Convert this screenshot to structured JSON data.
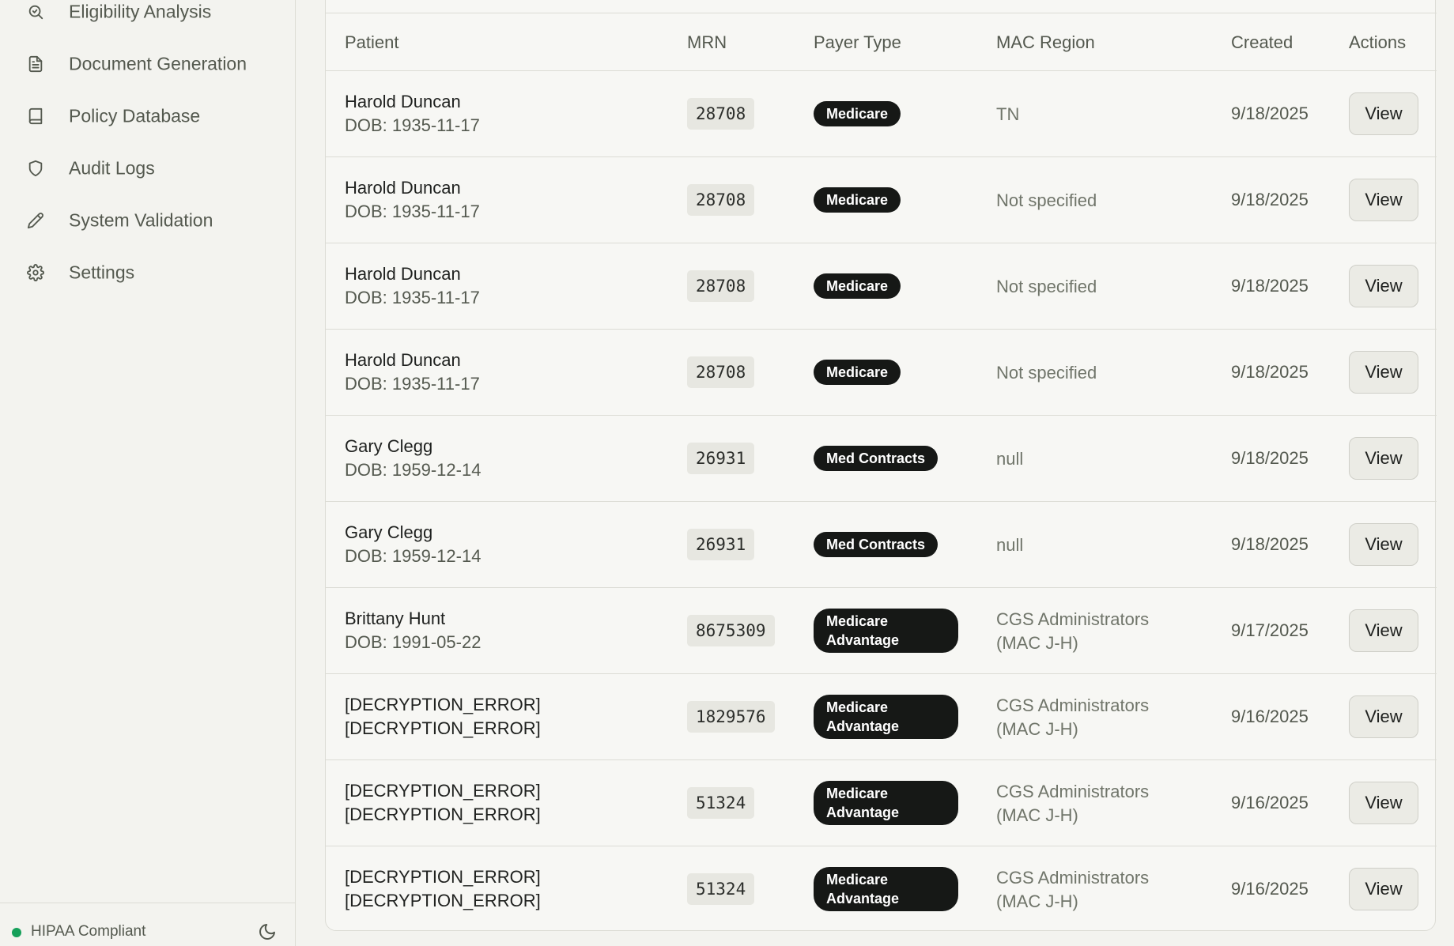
{
  "sidebar": {
    "items": [
      {
        "label": "Eligibility Analysis",
        "icon": "search-check-icon"
      },
      {
        "label": "Document Generation",
        "icon": "document-icon"
      },
      {
        "label": "Policy Database",
        "icon": "book-icon"
      },
      {
        "label": "Audit Logs",
        "icon": "shield-icon"
      },
      {
        "label": "System Validation",
        "icon": "pencil-icon"
      },
      {
        "label": "Settings",
        "icon": "gear-icon"
      }
    ],
    "footer": {
      "status": "HIPAA Compliant",
      "status_color": "#16a05a",
      "toggle_icon": "moon-icon"
    }
  },
  "table": {
    "headers": {
      "patient": "Patient",
      "mrn": "MRN",
      "payer": "Payer Type",
      "mac": "MAC Region",
      "created": "Created",
      "actions": "Actions"
    },
    "rows": [
      {
        "name": "Harold Duncan",
        "sub": "DOB: 1935-11-17",
        "mrn": "28708",
        "payer": "Medicare",
        "mac": "TN",
        "created": "9/18/2025",
        "action": "View"
      },
      {
        "name": "Harold Duncan",
        "sub": "DOB: 1935-11-17",
        "mrn": "28708",
        "payer": "Medicare",
        "mac": "Not specified",
        "created": "9/18/2025",
        "action": "View"
      },
      {
        "name": "Harold Duncan",
        "sub": "DOB: 1935-11-17",
        "mrn": "28708",
        "payer": "Medicare",
        "mac": "Not specified",
        "created": "9/18/2025",
        "action": "View"
      },
      {
        "name": "Harold Duncan",
        "sub": "DOB: 1935-11-17",
        "mrn": "28708",
        "payer": "Medicare",
        "mac": "Not specified",
        "created": "9/18/2025",
        "action": "View"
      },
      {
        "name": "Gary Clegg",
        "sub": "DOB: 1959-12-14",
        "mrn": "26931",
        "payer": "Med Contracts",
        "mac": "null",
        "created": "9/18/2025",
        "action": "View"
      },
      {
        "name": "Gary Clegg",
        "sub": "DOB: 1959-12-14",
        "mrn": "26931",
        "payer": "Med Contracts",
        "mac": "null",
        "created": "9/18/2025",
        "action": "View"
      },
      {
        "name": "Brittany Hunt",
        "sub": "DOB: 1991-05-22",
        "mrn": "8675309",
        "payer": "Medicare Advantage",
        "mac": "CGS Administrators (MAC J-H)",
        "created": "9/17/2025",
        "action": "View"
      },
      {
        "name": "[DECRYPTION_ERROR]",
        "sub": "[DECRYPTION_ERROR]",
        "mrn": "1829576",
        "payer": "Medicare Advantage",
        "mac": "CGS Administrators (MAC J-H)",
        "created": "9/16/2025",
        "action": "View"
      },
      {
        "name": "[DECRYPTION_ERROR]",
        "sub": "[DECRYPTION_ERROR]",
        "mrn": "51324",
        "payer": "Medicare Advantage",
        "mac": "CGS Administrators (MAC J-H)",
        "created": "9/16/2025",
        "action": "View"
      },
      {
        "name": "[DECRYPTION_ERROR]",
        "sub": "[DECRYPTION_ERROR]",
        "mrn": "51324",
        "payer": "Medicare Advantage",
        "mac": "CGS Administrators (MAC J-H)",
        "created": "9/16/2025",
        "action": "View"
      }
    ]
  }
}
